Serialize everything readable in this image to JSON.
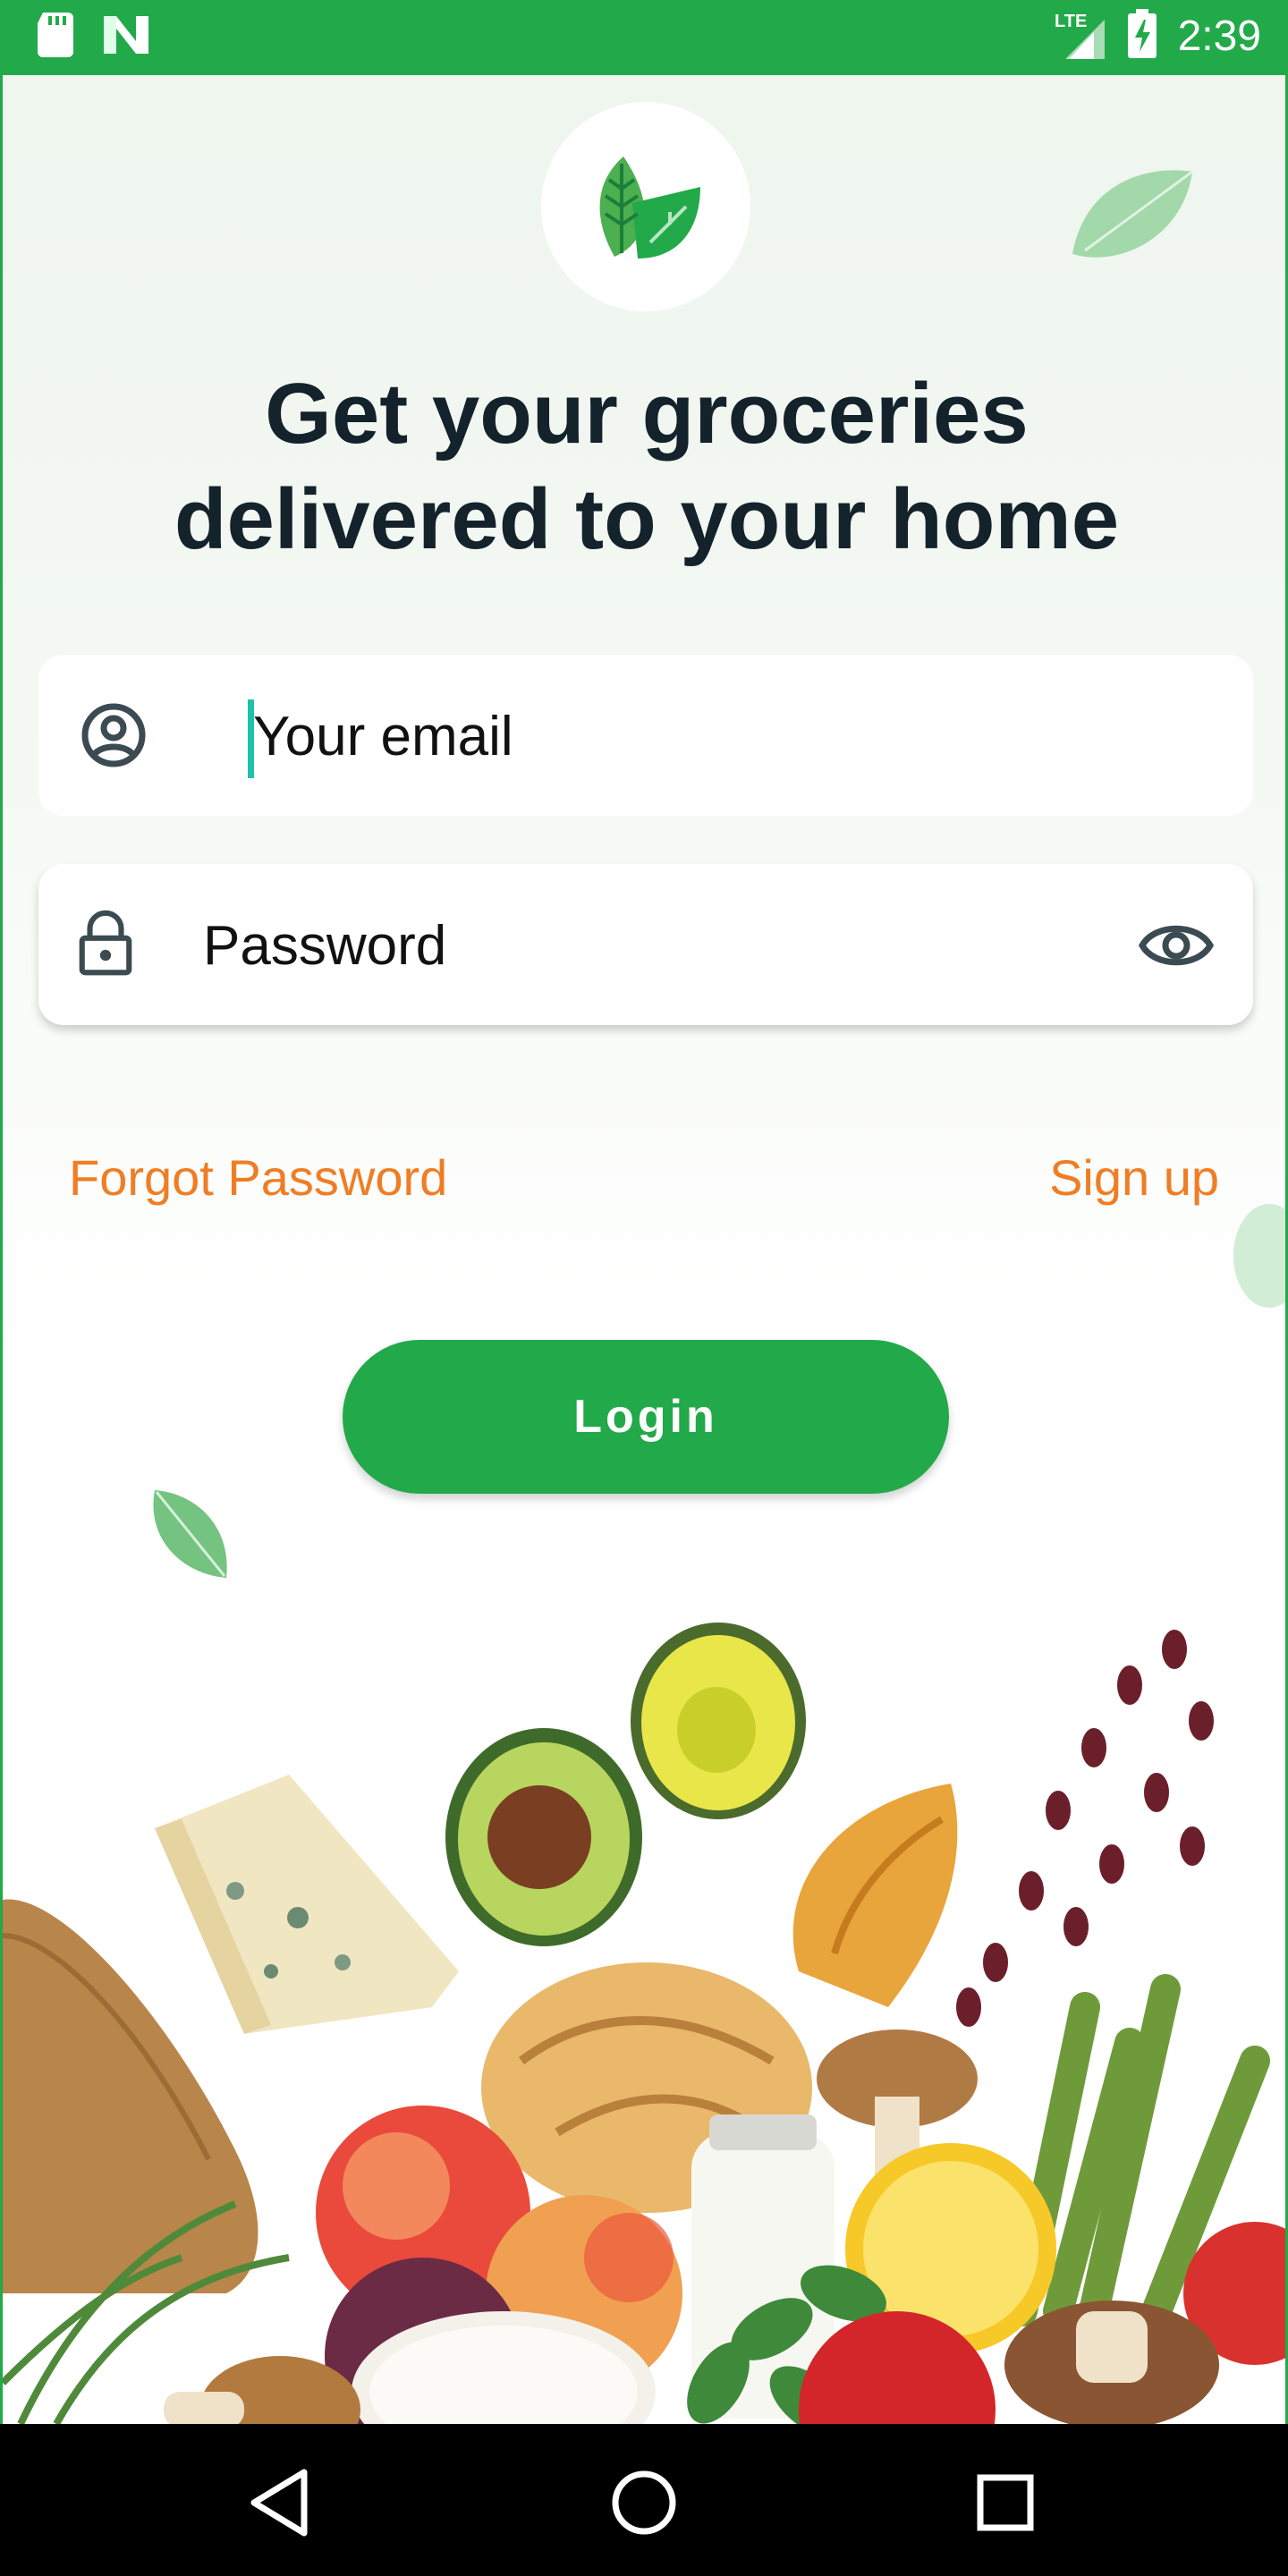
{
  "status_bar": {
    "time": "2:39",
    "network": "LTE",
    "icons": [
      "sd-card-icon",
      "n-icon",
      "signal-icon",
      "battery-charging-icon"
    ]
  },
  "header": {
    "logo_icon": "leaf-logo-icon",
    "headline": "Get your groceries delivered to your home"
  },
  "form": {
    "email_placeholder": "Your email",
    "password_placeholder": "Password",
    "email_icon": "user-circle-icon",
    "password_icon": "lock-icon",
    "visibility_icon": "eye-icon"
  },
  "links": {
    "forgot_password": "Forgot Password",
    "sign_up": "Sign up"
  },
  "actions": {
    "login_label": "Login"
  },
  "nav_bar": {
    "icons": [
      "back-icon",
      "home-icon",
      "recents-icon"
    ]
  },
  "colors": {
    "brand_green": "#22a94a",
    "link_orange": "#f07d24",
    "headline": "#13222b",
    "caret": "#1fc1a8"
  }
}
